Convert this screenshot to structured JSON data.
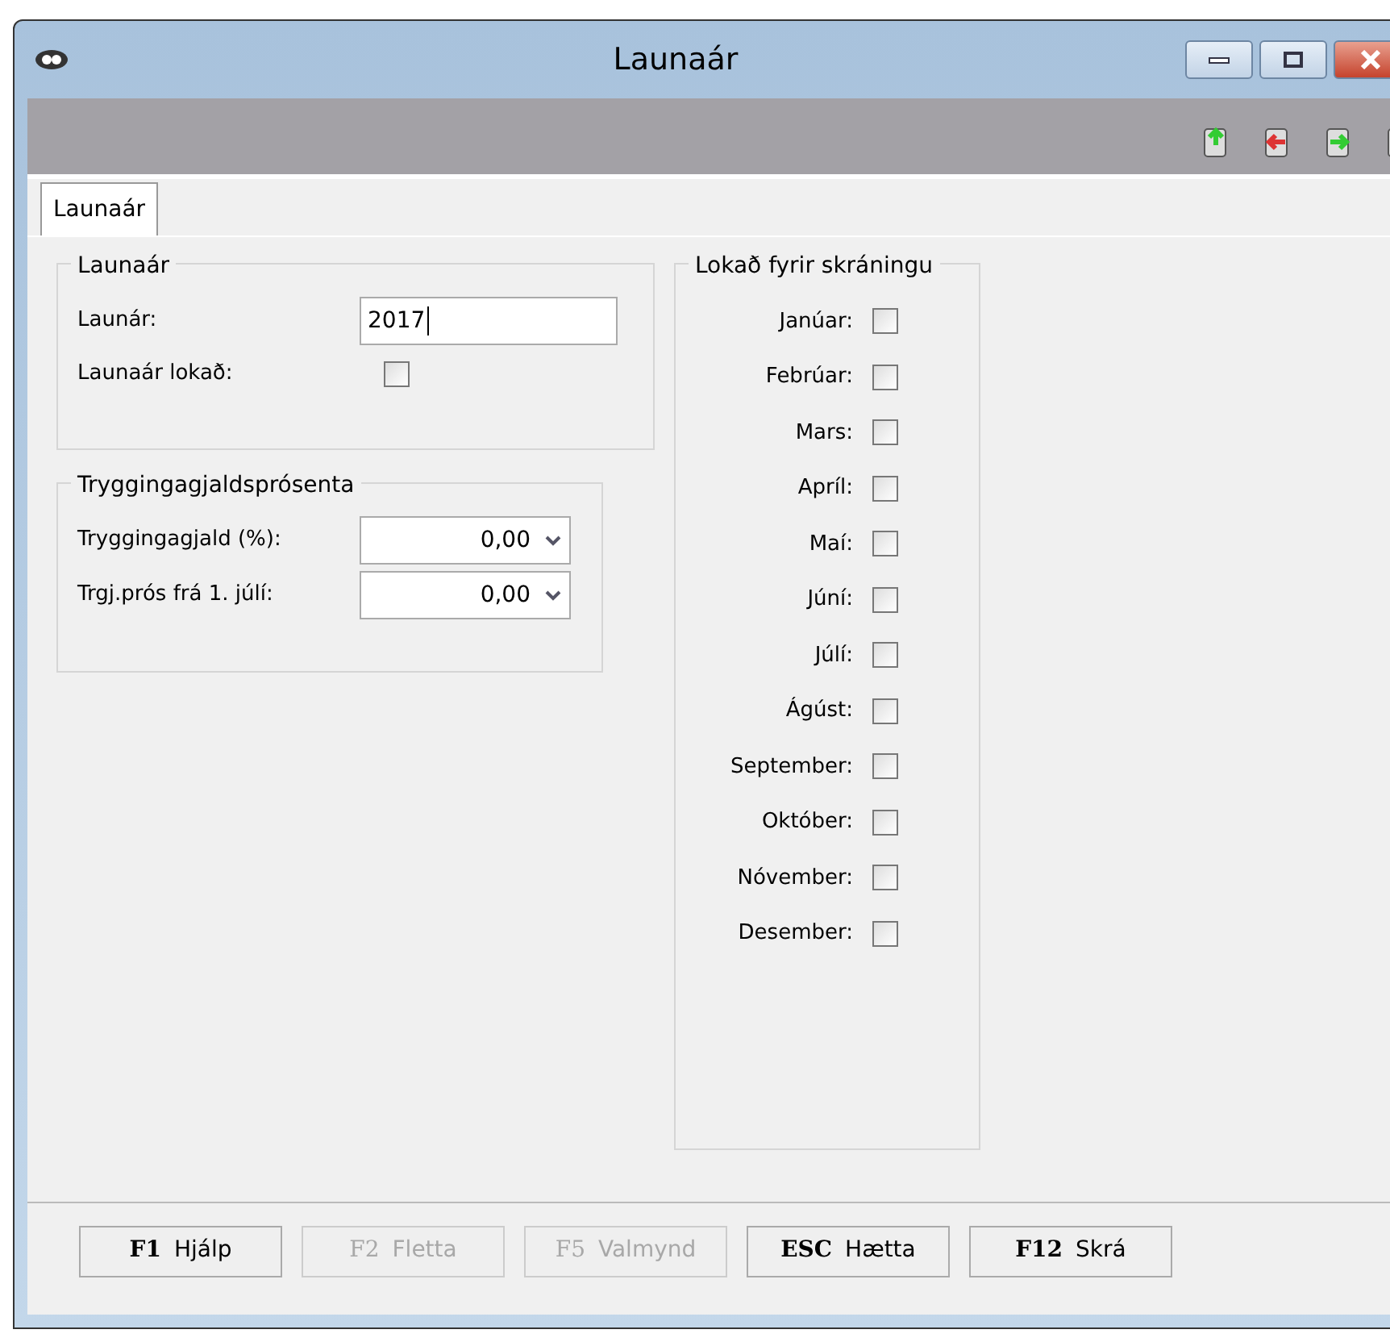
{
  "window": {
    "title": "Launaár"
  },
  "tabs": [
    {
      "label": "Launaár",
      "selected": true
    }
  ],
  "year_group": {
    "title": "Launaár",
    "year_label": "Launár:",
    "year_value": "2017",
    "closed_label": "Launaár lokað:",
    "closed_checked": false
  },
  "tax_group": {
    "title": "Tryggingagjaldsprósenta",
    "fields": [
      {
        "label": "Tryggingagjald (%):",
        "value": "0,00"
      },
      {
        "label": "Trgj.prós frá 1. júlí:",
        "value": "0,00"
      }
    ]
  },
  "months_group": {
    "title": "Lokað fyrir skráningu",
    "months": [
      {
        "label": "Janúar:",
        "checked": false
      },
      {
        "label": "Febrúar:",
        "checked": false
      },
      {
        "label": "Mars:",
        "checked": false
      },
      {
        "label": "Apríl:",
        "checked": false
      },
      {
        "label": "Maí:",
        "checked": false
      },
      {
        "label": "Júní:",
        "checked": false
      },
      {
        "label": "Júlí:",
        "checked": false
      },
      {
        "label": "Ágúst:",
        "checked": false
      },
      {
        "label": "September:",
        "checked": false
      },
      {
        "label": "Október:",
        "checked": false
      },
      {
        "label": "Nóvember:",
        "checked": false
      },
      {
        "label": "Desember:",
        "checked": false
      }
    ]
  },
  "buttons": [
    {
      "key": "F1",
      "label": "Hjálp",
      "disabled": false
    },
    {
      "key": "F2",
      "label": "Fletta",
      "disabled": true
    },
    {
      "key": "F5",
      "label": "Valmynd",
      "disabled": true
    },
    {
      "key": "ESC",
      "label": "Hætta",
      "disabled": false
    },
    {
      "key": "F12",
      "label": "Skrá",
      "disabled": false
    }
  ]
}
